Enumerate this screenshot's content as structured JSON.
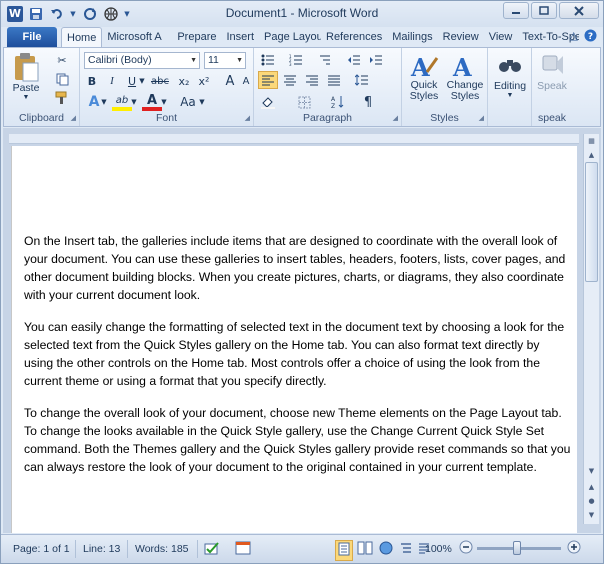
{
  "window": {
    "title": "Document1  -  Microsoft Word"
  },
  "qat": {
    "app_icon": "word-logo-icon",
    "save_icon": "save-icon",
    "undo_icon": "undo-icon",
    "redo_icon": "redo-icon",
    "customize_icon": "chevron-down-icon"
  },
  "tabs": {
    "file": "File",
    "items": [
      "Home",
      "Microsoft A",
      "Prepare",
      "Insert",
      "Page Layou",
      "References",
      "Mailings",
      "Review",
      "View",
      "Text-To-Spe"
    ]
  },
  "ribbon": {
    "clipboard": {
      "label": "Clipboard",
      "paste": "Paste"
    },
    "font": {
      "label": "Font",
      "font_name": "Calibri (Body)",
      "font_size": "11",
      "bold": "B",
      "italic": "I",
      "underline": "U",
      "strike": "abc",
      "subscript": "x₂",
      "superscript": "x²",
      "grow": "A",
      "shrink": "A",
      "text_effects": "A",
      "highlight": "ab",
      "font_color": "A",
      "change_case": "Aa"
    },
    "paragraph": {
      "label": "Paragraph"
    },
    "styles": {
      "label": "Styles",
      "quick_styles": "Quick\nStyles",
      "change_styles": "Change\nStyles"
    },
    "editing": {
      "label": "Editing"
    },
    "speak": {
      "label": "speak",
      "speak_btn": "Speak"
    }
  },
  "document": {
    "paragraphs": [
      "On the Insert tab, the galleries include items that are designed to coordinate with the overall look of your document. You can use these galleries to insert tables, headers, footers, lists, cover pages, and other document building blocks. When you create pictures, charts, or diagrams, they also coordinate with your current document look.",
      "You can easily change the formatting of selected text in the document text by choosing a look for the selected text from the Quick Styles gallery on the Home tab. You can also format text directly by using the other controls on the Home tab. Most controls offer a choice of using the look from the current theme or using a format that you specify directly.",
      "To change the overall look of your document, choose new Theme elements on the Page Layout tab. To change the looks available in the Quick Style gallery, use the Change Current Quick Style Set command. Both the Themes gallery and the Quick Styles gallery provide reset commands so that you can always restore the look of your document to the original contained in your current template."
    ]
  },
  "status": {
    "page": "Page: 1 of 1",
    "line": "Line: 13",
    "words": "Words: 185",
    "zoom": "100%",
    "zoom_level_percent": 100
  }
}
